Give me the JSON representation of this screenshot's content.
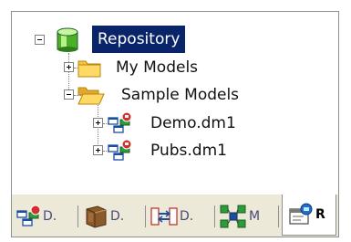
{
  "tree": {
    "root": {
      "label": "Repository",
      "icon": "database-icon"
    },
    "folders": [
      {
        "label": "My Models",
        "icon": "folder-icon",
        "expanded": false
      },
      {
        "label": "Sample Models",
        "icon": "open-folder-icon",
        "expanded": true
      }
    ],
    "models": [
      {
        "label": "Demo.dm1",
        "icon": "model-diagram-icon"
      },
      {
        "label": "Pubs.dm1",
        "icon": "model-diagram-icon"
      }
    ]
  },
  "tabs": [
    {
      "label": "D.",
      "icon": "model-diagram-icon"
    },
    {
      "label": "D.",
      "icon": "data-dictionary-icon"
    },
    {
      "label": "D.",
      "icon": "data-lineage-icon"
    },
    {
      "label": "M",
      "icon": "macro-icon"
    },
    {
      "label": "R",
      "icon": "repository-icon",
      "active": true
    }
  ],
  "colors": {
    "selection": "#0a246a",
    "folder": "#f5c542",
    "database": "#4caf2a"
  }
}
